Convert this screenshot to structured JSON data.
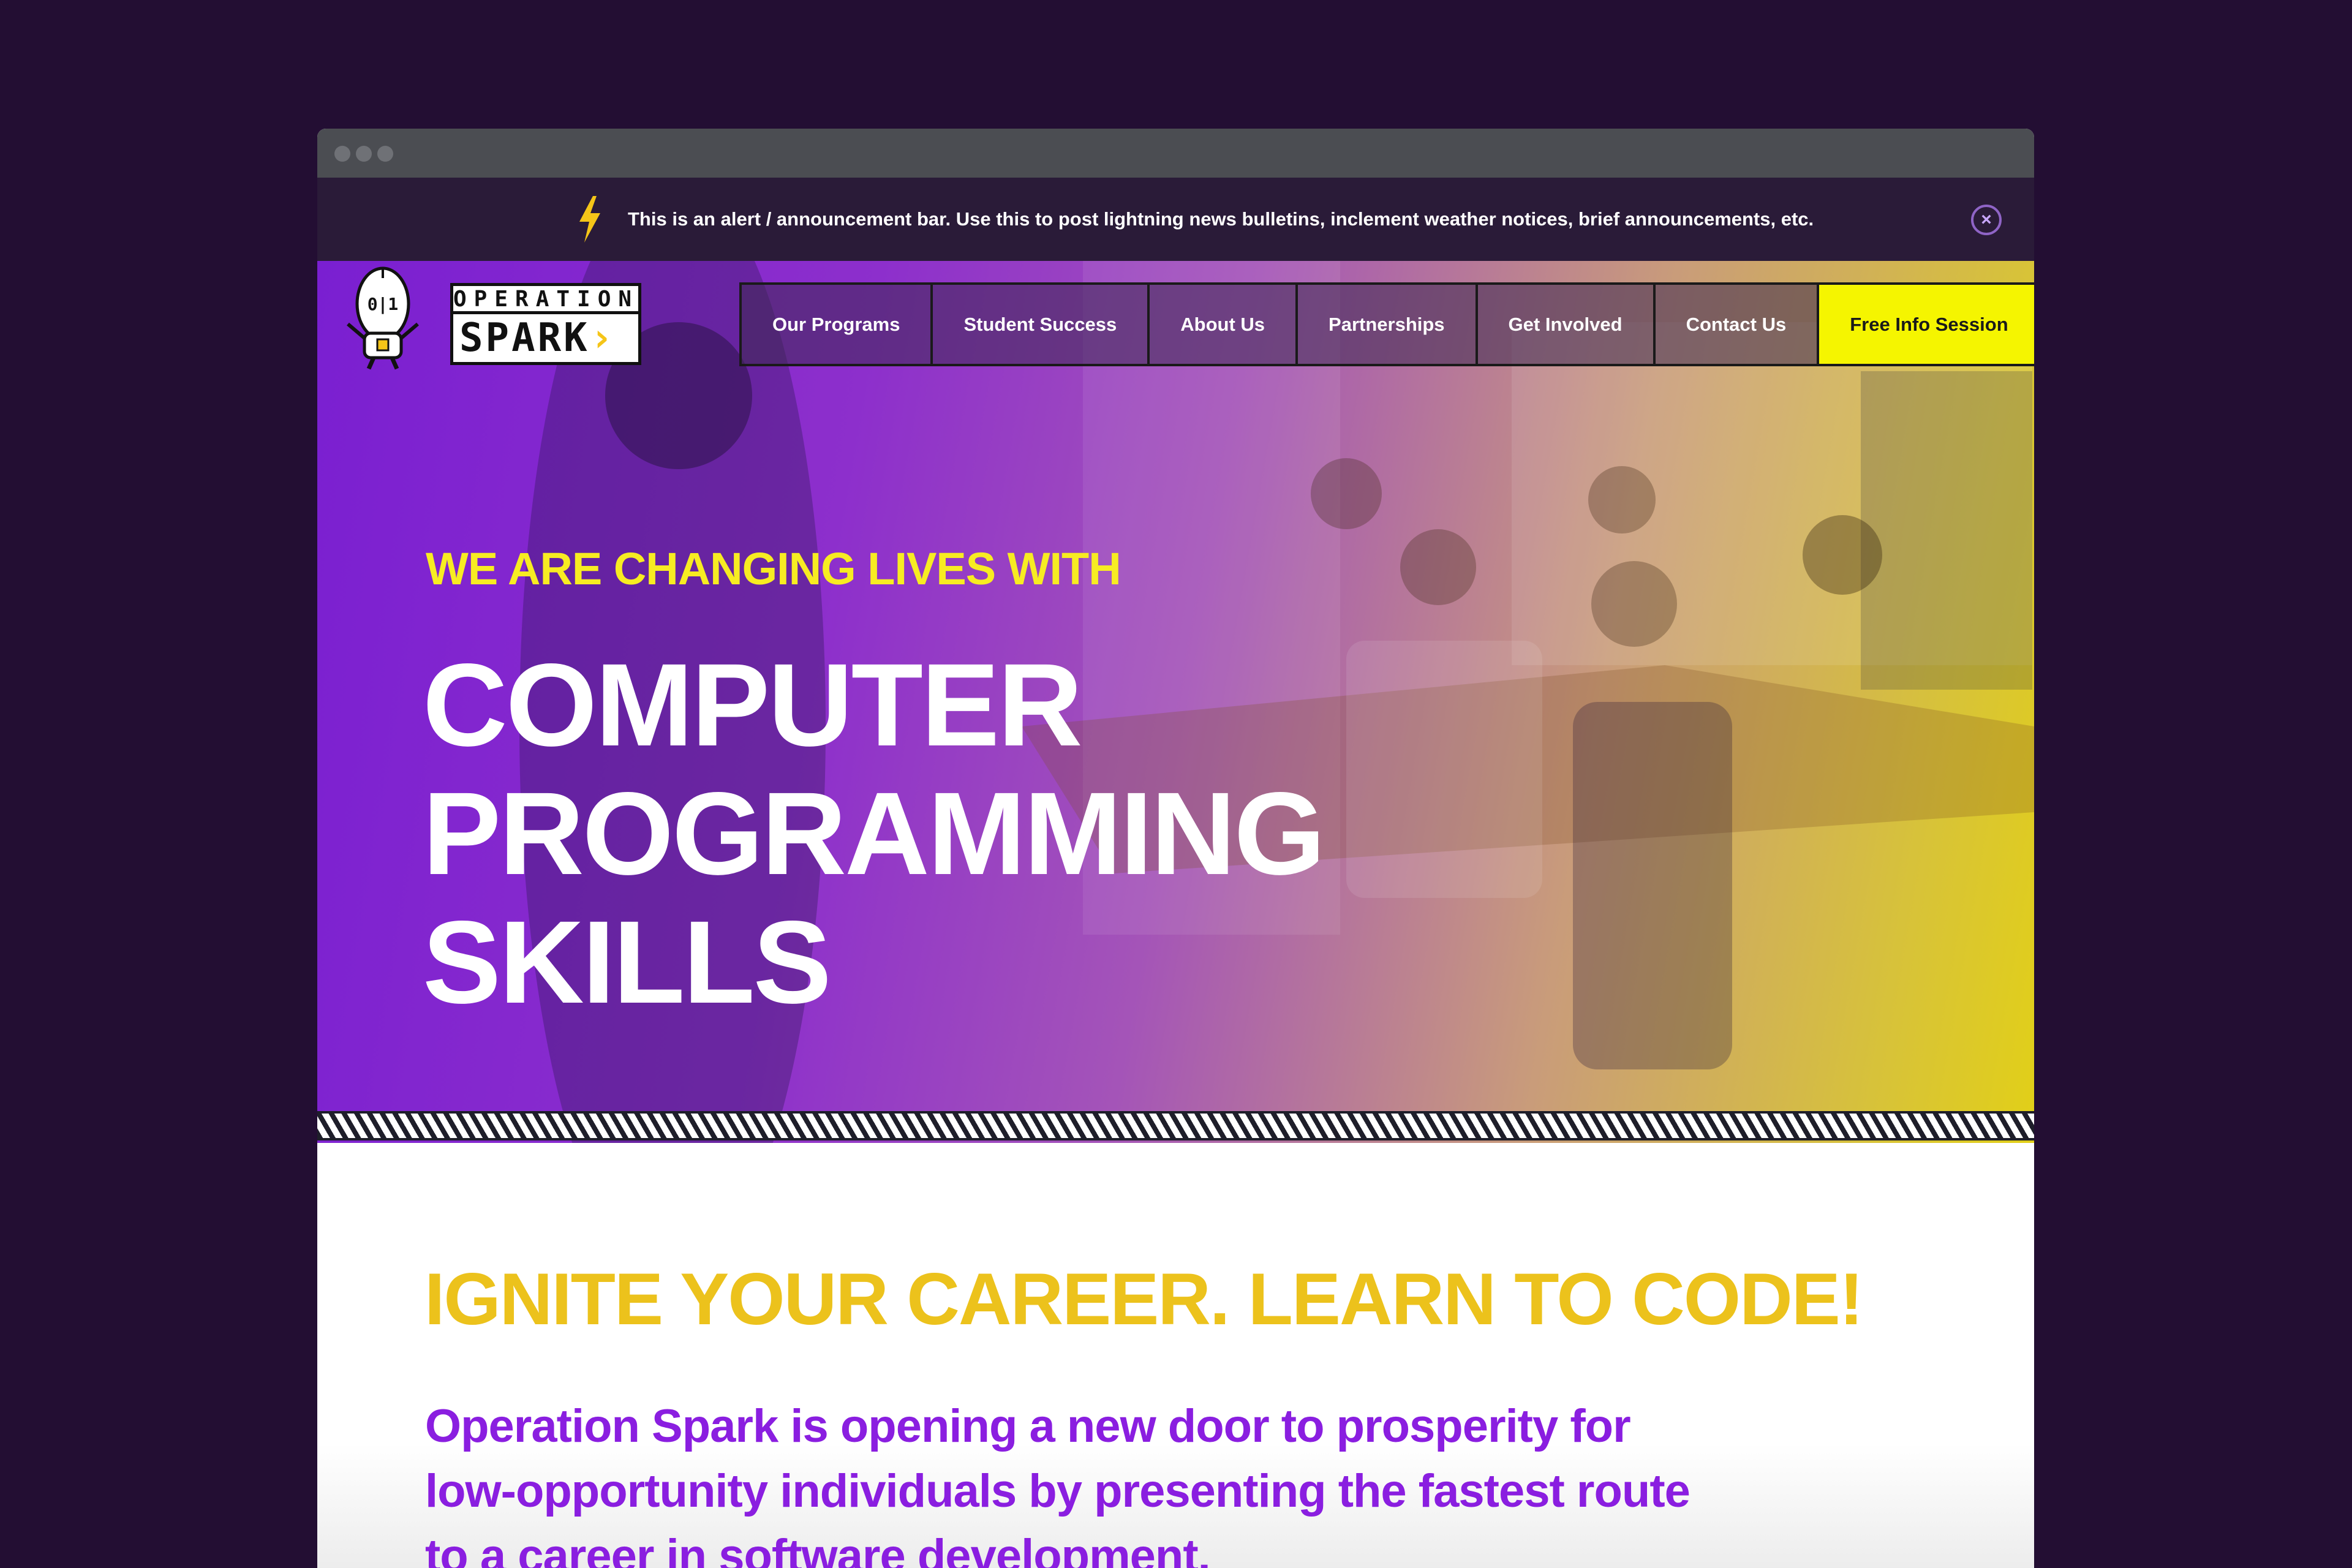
{
  "alert": {
    "text": "This is an alert / announcement bar. Use this to post lightning news bulletins, inclement weather notices, brief announcements, etc.",
    "close_symbol": "×"
  },
  "logo": {
    "top": "OPERATION",
    "bottom": "SPARK",
    "mascot_text": "0|1"
  },
  "nav": {
    "items": [
      "Our Programs",
      "Student Success",
      "About Us",
      "Partnerships",
      "Get Involved",
      "Contact Us"
    ],
    "cta": "Free Info Session"
  },
  "hero": {
    "eyebrow": "WE ARE CHANGING LIVES WITH",
    "headline": [
      "COMPUTER",
      "PROGRAMMING",
      "SKILLS"
    ]
  },
  "content": {
    "heading": "IGNITE YOUR CAREER. LEARN TO CODE!",
    "intro": "Operation Spark is opening a new door to prosperity for low-opportunity individuals by presenting the fastest route to a career in software development."
  },
  "colors": {
    "page_background": "#230e33",
    "alert_bar": "#2a1b38",
    "accent_yellow": "#f5f500",
    "heading_gold": "#ecc21c",
    "brand_purple": "#8a1ee0"
  },
  "icons": [
    "lightning-bolt-icon",
    "close-icon",
    "mascot-robot-icon",
    "window-dot-icon"
  ]
}
